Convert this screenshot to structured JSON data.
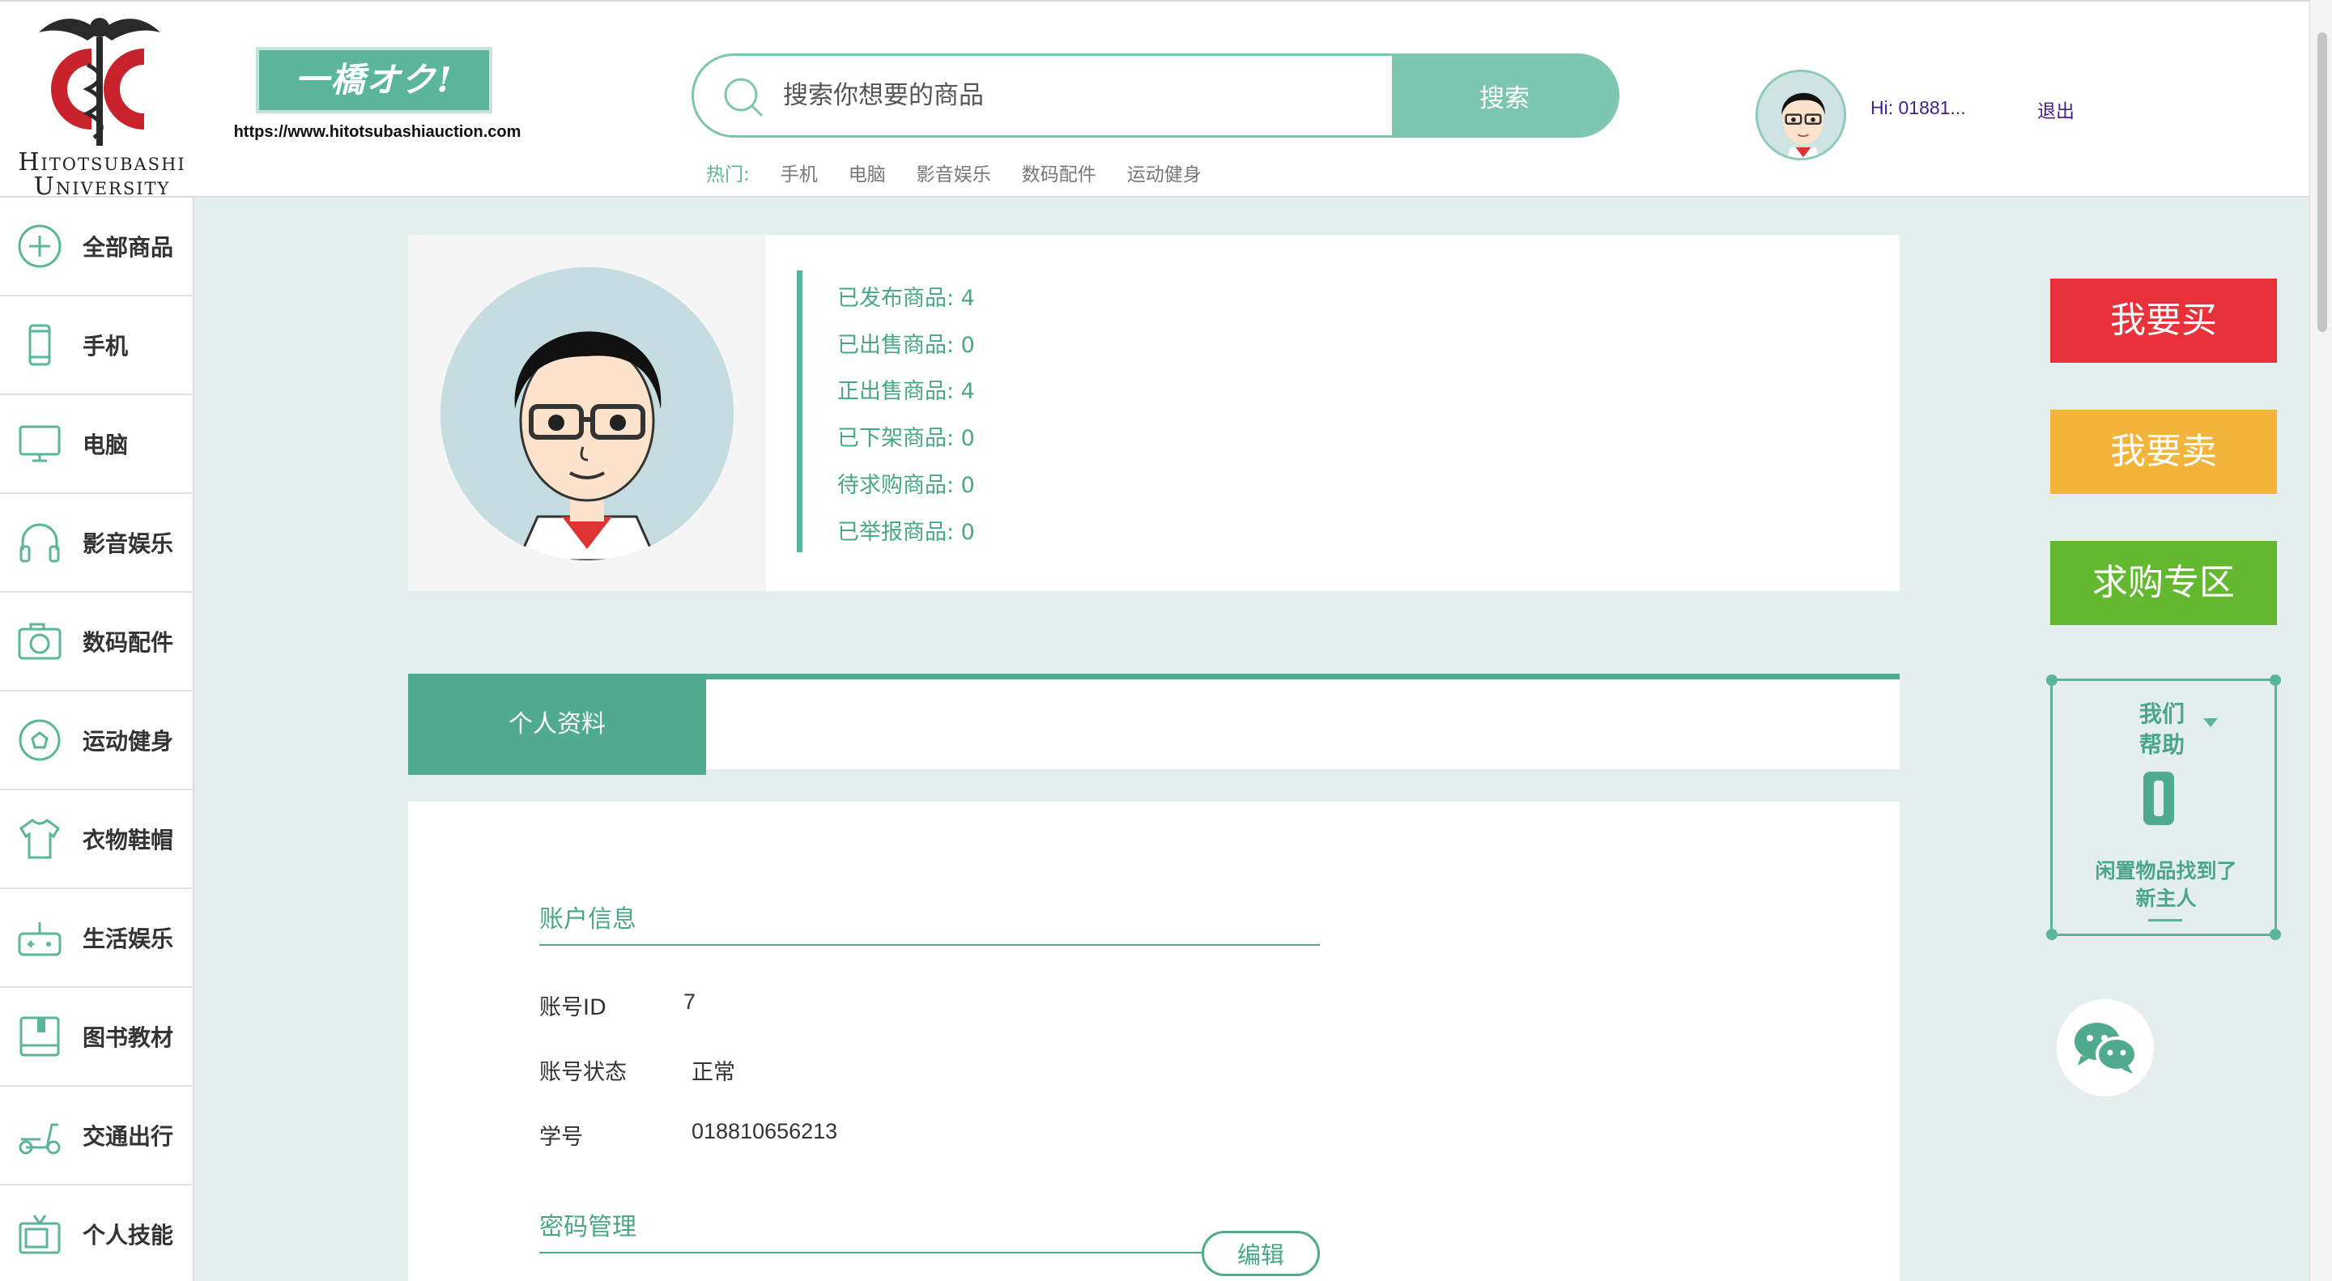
{
  "header": {
    "university": "Hitotsubashi University",
    "site_badge": "一橋オク!",
    "site_url": "https://www.hitotsubashiauction.com",
    "search": {
      "placeholder": "搜索你想要的商品",
      "button": "搜索"
    },
    "hot": {
      "label": "热门:",
      "links": [
        "手机",
        "电脑",
        "影音娱乐",
        "数码配件",
        "运动健身"
      ]
    },
    "user": {
      "greeting": "Hi: 01881...",
      "logout": "退出"
    }
  },
  "sidebar": {
    "items": [
      {
        "label": "全部商品",
        "icon": "plus-circle-icon"
      },
      {
        "label": "手机",
        "icon": "phone-icon"
      },
      {
        "label": "电脑",
        "icon": "monitor-icon"
      },
      {
        "label": "影音娱乐",
        "icon": "headphones-icon"
      },
      {
        "label": "数码配件",
        "icon": "camera-icon"
      },
      {
        "label": "运动健身",
        "icon": "football-icon"
      },
      {
        "label": "衣物鞋帽",
        "icon": "shirt-icon"
      },
      {
        "label": "生活娱乐",
        "icon": "gamepad-icon"
      },
      {
        "label": "图书教材",
        "icon": "book-icon"
      },
      {
        "label": "交通出行",
        "icon": "scooter-icon"
      },
      {
        "label": "个人技能",
        "icon": "tv-icon"
      }
    ]
  },
  "profile": {
    "stats": [
      "已发布商品: 4",
      "已出售商品: 0",
      "正出售商品: 4",
      "已下架商品: 0",
      "待求购商品: 0",
      "已举报商品: 0"
    ]
  },
  "tabs": {
    "active": "个人资料"
  },
  "account": {
    "section_title": "账户信息",
    "rows": [
      {
        "label": "账号ID",
        "value": "7"
      },
      {
        "label": "账号状态",
        "value": "正常"
      },
      {
        "label": "学号",
        "value": "018810656213"
      }
    ],
    "password_title": "密码管理",
    "edit_button": "编辑"
  },
  "actions": {
    "buy": "我要买",
    "sell": "我要卖",
    "wanted": "求购专区",
    "colors": {
      "buy": "#e8313b",
      "sell": "#f3b43b",
      "wanted": "#63b830"
    }
  },
  "help": {
    "title_line1": "我们",
    "title_line2": "帮助",
    "sub_line1": "闲置物品找到了",
    "sub_line2": "新主人"
  }
}
